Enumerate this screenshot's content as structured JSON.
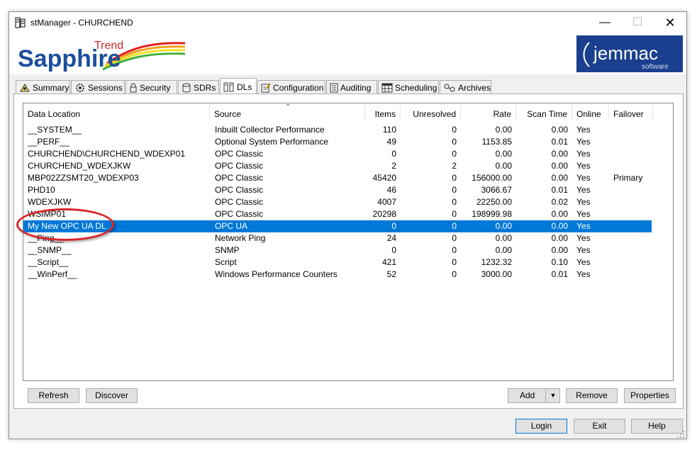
{
  "window": {
    "title": "stManager - CHURCHEND"
  },
  "logos": {
    "sapphire_main": "Sapphire",
    "sapphire_sup": "Trend",
    "jemmac_main": "jemmac",
    "jemmac_sub": "software"
  },
  "tabs": [
    {
      "label": "Summary",
      "icon": "summary-icon",
      "active": false
    },
    {
      "label": "Sessions",
      "icon": "gear-icon",
      "active": false
    },
    {
      "label": "Security",
      "icon": "lock-icon",
      "active": false
    },
    {
      "label": "SDRs",
      "icon": "database-icon",
      "active": false
    },
    {
      "label": "DLs",
      "icon": "datalocation-icon",
      "active": true
    },
    {
      "label": "Configuration",
      "icon": "configuration-icon",
      "active": false
    },
    {
      "label": "Auditing",
      "icon": "document-icon",
      "active": false
    },
    {
      "label": "Scheduling",
      "icon": "calendar-icon",
      "active": false
    },
    {
      "label": "Archives",
      "icon": "archive-icon",
      "active": false
    }
  ],
  "columns": [
    {
      "key": "location",
      "label": "Data Location",
      "align": "left"
    },
    {
      "key": "source",
      "label": "Source",
      "align": "left"
    },
    {
      "key": "items",
      "label": "Items",
      "align": "right"
    },
    {
      "key": "unresolved",
      "label": "Unresolved",
      "align": "right"
    },
    {
      "key": "rate",
      "label": "Rate",
      "align": "right"
    },
    {
      "key": "scan",
      "label": "Scan Time",
      "align": "right"
    },
    {
      "key": "online",
      "label": "Online",
      "align": "left"
    },
    {
      "key": "failover",
      "label": "Failover",
      "align": "left"
    }
  ],
  "rows": [
    {
      "location": "__SYSTEM__",
      "source": "Inbuilt Collector Performance",
      "items": "110",
      "unresolved": "0",
      "rate": "0.00",
      "scan": "0.00",
      "online": "Yes",
      "failover": ""
    },
    {
      "location": "__PERF__",
      "source": "Optional System Performance",
      "items": "49",
      "unresolved": "0",
      "rate": "1153.85",
      "scan": "0.01",
      "online": "Yes",
      "failover": ""
    },
    {
      "location": "CHURCHEND\\CHURCHEND_WDEXP01",
      "source": "OPC Classic",
      "items": "0",
      "unresolved": "0",
      "rate": "0.00",
      "scan": "0.00",
      "online": "Yes",
      "failover": ""
    },
    {
      "location": "CHURCHEND_WDEXJKW",
      "source": "OPC Classic",
      "items": "2",
      "unresolved": "2",
      "rate": "0.00",
      "scan": "0.00",
      "online": "Yes",
      "failover": ""
    },
    {
      "location": "MBP02ZZSMT20_WDEXP03",
      "source": "OPC Classic",
      "items": "45420",
      "unresolved": "0",
      "rate": "156000.00",
      "scan": "0.00",
      "online": "Yes",
      "failover": "Primary"
    },
    {
      "location": "PHD10",
      "source": "OPC Classic",
      "items": "46",
      "unresolved": "0",
      "rate": "3066.67",
      "scan": "0.01",
      "online": "Yes",
      "failover": ""
    },
    {
      "location": "WDEXJKW",
      "source": "OPC Classic",
      "items": "4007",
      "unresolved": "0",
      "rate": "22250.00",
      "scan": "0.02",
      "online": "Yes",
      "failover": ""
    },
    {
      "location": "WSIMP01",
      "source": "OPC Classic",
      "items": "20298",
      "unresolved": "0",
      "rate": "198999.98",
      "scan": "0.00",
      "online": "Yes",
      "failover": ""
    },
    {
      "location": "My New OPC UA DL",
      "source": "OPC UA",
      "items": "0",
      "unresolved": "0",
      "rate": "0.00",
      "scan": "0.00",
      "online": "Yes",
      "failover": "",
      "selected": true
    },
    {
      "location": "__Ping__",
      "source": "Network Ping",
      "items": "24",
      "unresolved": "0",
      "rate": "0.00",
      "scan": "0.00",
      "online": "Yes",
      "failover": ""
    },
    {
      "location": "__SNMP__",
      "source": "SNMP",
      "items": "0",
      "unresolved": "0",
      "rate": "0.00",
      "scan": "0.00",
      "online": "Yes",
      "failover": ""
    },
    {
      "location": "__Script__",
      "source": "Script",
      "items": "421",
      "unresolved": "0",
      "rate": "1232.32",
      "scan": "0.10",
      "online": "Yes",
      "failover": ""
    },
    {
      "location": "__WinPerf__",
      "source": "Windows Performance Counters",
      "items": "52",
      "unresolved": "0",
      "rate": "3000.00",
      "scan": "0.01",
      "online": "Yes",
      "failover": ""
    }
  ],
  "panel_buttons": {
    "refresh": "Refresh",
    "discover": "Discover",
    "add": "Add",
    "remove": "Remove",
    "properties": "Properties"
  },
  "footer_buttons": {
    "login": "Login",
    "exit": "Exit",
    "help": "Help"
  },
  "colors": {
    "selection": "#0078d7",
    "highlight_oval": "#d9252a",
    "sapphire_blue": "#1c4f9c",
    "jemmac_blue": "#1b3f8f"
  }
}
